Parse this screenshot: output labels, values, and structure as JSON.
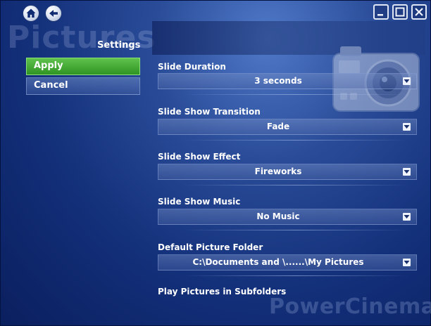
{
  "app": {
    "title_watermark": "Pictures",
    "brand_watermark": "PowerCinema"
  },
  "panel": {
    "title": "Settings"
  },
  "menu": {
    "apply_label": "Apply",
    "cancel_label": "Cancel"
  },
  "settings": [
    {
      "label": "Slide Duration",
      "value": "3 seconds"
    },
    {
      "label": "Slide Show Transition",
      "value": "Fade"
    },
    {
      "label": "Slide Show Effect",
      "value": "Fireworks"
    },
    {
      "label": "Slide Show Music",
      "value": "No Music"
    },
    {
      "label": "Default Picture Folder",
      "value": "C:\\Documents and \\......\\My Pictures"
    },
    {
      "label": "Play Pictures in Subfolders"
    }
  ],
  "icons": {
    "home": "home-icon",
    "back": "back-arrow-icon",
    "minimize": "minimize-icon",
    "maximize": "maximize-icon",
    "close": "close-icon",
    "dropdown": "chevron-down-icon"
  },
  "colors": {
    "background": "#1a3a85",
    "apply_green": "#3aa32d"
  }
}
